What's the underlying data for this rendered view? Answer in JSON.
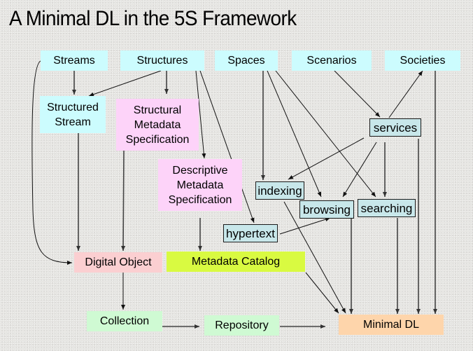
{
  "title": "A Minimal DL in the 5S Framework",
  "nodes": {
    "streams": "Streams",
    "structures": "Structures",
    "spaces": "Spaces",
    "scenarios": "Scenarios",
    "societies": "Societies",
    "structured_stream": "Structured Stream",
    "structural_metadata_spec": "Structural Metadata Specification",
    "descriptive_metadata_spec": "Descriptive Metadata Specification",
    "services": "services",
    "indexing": "indexing",
    "browsing": "browsing",
    "searching": "searching",
    "hypertext": "hypertext",
    "digital_object": "Digital Object",
    "metadata_catalog": "Metadata Catalog",
    "collection": "Collection",
    "repository": "Repository",
    "minimal_dl": "Minimal DL"
  },
  "edges": [
    [
      "streams",
      "structured_stream"
    ],
    [
      "streams",
      "digital_object"
    ],
    [
      "structures",
      "structured_stream"
    ],
    [
      "structures",
      "structural_metadata_spec"
    ],
    [
      "structures",
      "descriptive_metadata_spec"
    ],
    [
      "structures",
      "hypertext"
    ],
    [
      "spaces",
      "indexing"
    ],
    [
      "spaces",
      "browsing"
    ],
    [
      "spaces",
      "searching"
    ],
    [
      "scenarios",
      "services"
    ],
    [
      "services",
      "societies"
    ],
    [
      "services",
      "indexing"
    ],
    [
      "services",
      "browsing"
    ],
    [
      "services",
      "searching"
    ],
    [
      "services",
      "minimal_dl"
    ],
    [
      "societies",
      "minimal_dl"
    ],
    [
      "hypertext",
      "browsing"
    ],
    [
      "structured_stream",
      "digital_object"
    ],
    [
      "structural_metadata_spec",
      "digital_object"
    ],
    [
      "descriptive_metadata_spec",
      "metadata_catalog"
    ],
    [
      "indexing",
      "minimal_dl"
    ],
    [
      "browsing",
      "minimal_dl"
    ],
    [
      "searching",
      "minimal_dl"
    ],
    [
      "metadata_catalog",
      "minimal_dl"
    ],
    [
      "digital_object",
      "collection"
    ],
    [
      "collection",
      "repository"
    ],
    [
      "repository",
      "minimal_dl"
    ]
  ],
  "colors": {
    "s_concept": "#ccfcfe",
    "metadata_spec": "#fdd3f9",
    "service": "#c8e7ea",
    "digital_object": "#fbcfd1",
    "metadata_catalog": "#d9fa41",
    "collection_repository": "#cffad3",
    "minimal_dl": "#fed5ab"
  }
}
